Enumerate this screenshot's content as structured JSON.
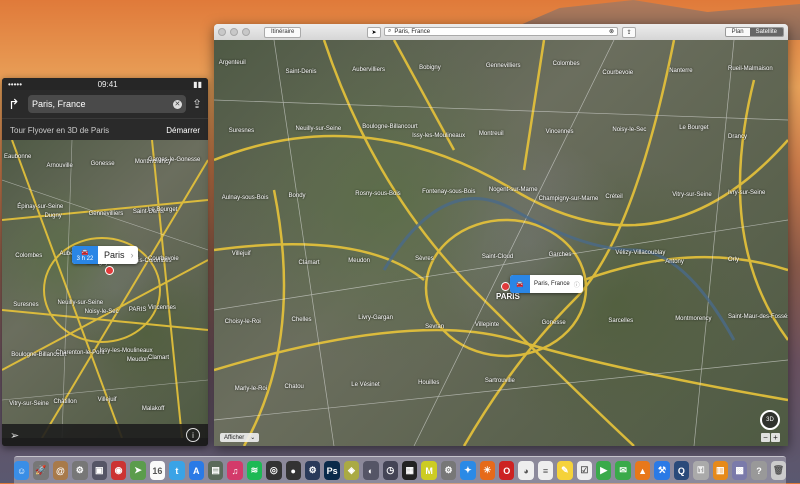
{
  "phone": {
    "status": {
      "time": "09:41"
    },
    "search": {
      "query": "Paris, France"
    },
    "flyover": {
      "label": "Tour Flyover en 3D de Paris",
      "start": "Démarrer"
    },
    "callout": {
      "eta": "3 h 22",
      "place": "Paris"
    },
    "map_labels": [
      "Eaubonne",
      "Arnouville",
      "Gonesse",
      "Montmorency",
      "Garges-le-Gonesse",
      "Épinay-sur-Seine",
      "Dugny",
      "Gennevilliers",
      "Saint-Denis",
      "Le Bourget",
      "Colombes",
      "Aubervilliers",
      "Bobigny",
      "Bois-Colombes",
      "Courbevoie",
      "Suresnes",
      "Neuilly-sur-Seine",
      "Noisy-le-Sec",
      "PARIS",
      "Vincennes",
      "Boulogne-Billancourt",
      "Charenton-le-Pont",
      "Issy-les-Moulineaux",
      "Meudon",
      "Clamart",
      "Vitry-sur-Seine",
      "Châtillon",
      "Villejuif",
      "Malakoff"
    ]
  },
  "window": {
    "itinerary_button": "Itinéraire",
    "search": {
      "query": "Paris, France"
    },
    "segments": [
      {
        "label": "Plan",
        "selected": false
      },
      {
        "label": "Satellite",
        "selected": true
      }
    ],
    "callout": {
      "place": "Paris, France"
    },
    "city_label": "PARIS",
    "show_menu": "Afficher",
    "compass": "3D",
    "zoom_out": "−",
    "zoom_in": "+",
    "map_labels": [
      "Argenteuil",
      "Saint-Denis",
      "Aubervilliers",
      "Bobigny",
      "Gennevilliers",
      "Colombes",
      "Courbevoie",
      "Nanterre",
      "Rueil-Malmaison",
      "Suresnes",
      "Neuilly-sur-Seine",
      "Boulogne-Billancourt",
      "Issy-les-Moulineaux",
      "Montreuil",
      "Vincennes",
      "Noisy-le-Sec",
      "Le Bourget",
      "Drancy",
      "Aulnay-sous-Bois",
      "Bondy",
      "Rosny-sous-Bois",
      "Fontenay-sous-Bois",
      "Nogent-sur-Marne",
      "Champigny-sur-Marne",
      "Créteil",
      "Vitry-sur-Seine",
      "Ivry-sur-Seine",
      "Villejuif",
      "Clamart",
      "Meudon",
      "Sèvres",
      "Saint-Cloud",
      "Garches",
      "Vélizy-Villacoublay",
      "Antony",
      "Orly",
      "Choisy-le-Roi",
      "Chelles",
      "Livry-Gargan",
      "Sevran",
      "Villepinte",
      "Gonesse",
      "Sarcelles",
      "Montmorency",
      "Saint-Maur-des-Fossés",
      "Marly-le-Roi",
      "Chatou",
      "Le Vésinet",
      "Houilles",
      "Sartrouville"
    ]
  },
  "dock": {
    "apps": [
      {
        "name": "finder-icon",
        "color": "#3a8ee6",
        "glyph": "☺"
      },
      {
        "name": "launchpad-icon",
        "color": "#777",
        "glyph": "🚀"
      },
      {
        "name": "contacts-icon",
        "color": "#a87a4a",
        "glyph": "@"
      },
      {
        "name": "automator-icon",
        "color": "#777",
        "glyph": "⚙"
      },
      {
        "name": "preview-icon",
        "color": "#556",
        "glyph": "▣"
      },
      {
        "name": "photo-booth-icon",
        "color": "#c33",
        "glyph": "◉"
      },
      {
        "name": "maps-icon",
        "color": "#5b9c4c",
        "glyph": "➤"
      },
      {
        "name": "calendar-icon",
        "color": "#fafafa",
        "glyph": "16"
      },
      {
        "name": "twitter-icon",
        "color": "#3aa3e6",
        "glyph": "t"
      },
      {
        "name": "app-store-icon",
        "color": "#2a7ae6",
        "glyph": "A"
      },
      {
        "name": "image-capture-icon",
        "color": "#5a6a5a",
        "glyph": "▤"
      },
      {
        "name": "itunes-icon",
        "color": "#d33a6a",
        "glyph": "♫"
      },
      {
        "name": "spotify-icon",
        "color": "#1db954",
        "glyph": "≋"
      },
      {
        "name": "aperture-icon",
        "color": "#333",
        "glyph": "◎"
      },
      {
        "name": "dvd-player-icon",
        "color": "#333",
        "glyph": "●"
      },
      {
        "name": "steam-icon",
        "color": "#2a3a5a",
        "glyph": "⚙"
      },
      {
        "name": "photoshop-icon",
        "color": "#0a2a4a",
        "glyph": "Ps"
      },
      {
        "name": "transmit-icon",
        "color": "#aa4",
        "glyph": "◈"
      },
      {
        "name": "network-radar-icon",
        "color": "#556",
        "glyph": "◐"
      },
      {
        "name": "time-machine-icon",
        "color": "#445",
        "glyph": "◷"
      },
      {
        "name": "activity-monitor-icon",
        "color": "#222",
        "glyph": "▦"
      },
      {
        "name": "moneymoney-icon",
        "color": "#cc2",
        "glyph": "M"
      },
      {
        "name": "system-prefs-icon",
        "color": "#777",
        "glyph": "⚙"
      },
      {
        "name": "safari-icon",
        "color": "#2a8ae6",
        "glyph": "✦"
      },
      {
        "name": "firefox-icon",
        "color": "#e66a1a",
        "glyph": "☀"
      },
      {
        "name": "opera-icon",
        "color": "#c22",
        "glyph": "O"
      },
      {
        "name": "chrome-icon",
        "color": "#eee",
        "glyph": "◕"
      },
      {
        "name": "textedit-icon",
        "color": "#eee",
        "glyph": "≡"
      },
      {
        "name": "notes-icon",
        "color": "#f5d23a",
        "glyph": "✎"
      },
      {
        "name": "reminders-icon",
        "color": "#eee",
        "glyph": "☑"
      },
      {
        "name": "facetime-icon",
        "color": "#3aaa4a",
        "glyph": "▶"
      },
      {
        "name": "messages-icon",
        "color": "#3aaa4a",
        "glyph": "✉"
      },
      {
        "name": "vlc-icon",
        "color": "#e8781a",
        "glyph": "▲"
      },
      {
        "name": "xcode-icon",
        "color": "#2a7ae6",
        "glyph": "⚒"
      },
      {
        "name": "quicktime-icon",
        "color": "#2a4a7a",
        "glyph": "Q"
      },
      {
        "name": "keychain-icon",
        "color": "#aaa",
        "glyph": "⚿"
      },
      {
        "name": "books-icon",
        "color": "#e68a1a",
        "glyph": "▥"
      },
      {
        "name": "hardware-icon",
        "color": "#7a7aaa",
        "glyph": "▩"
      },
      {
        "name": "help-icon",
        "color": "#999",
        "glyph": "?"
      },
      {
        "name": "trash-icon",
        "color": "#ccc",
        "glyph": "🗑"
      }
    ]
  }
}
